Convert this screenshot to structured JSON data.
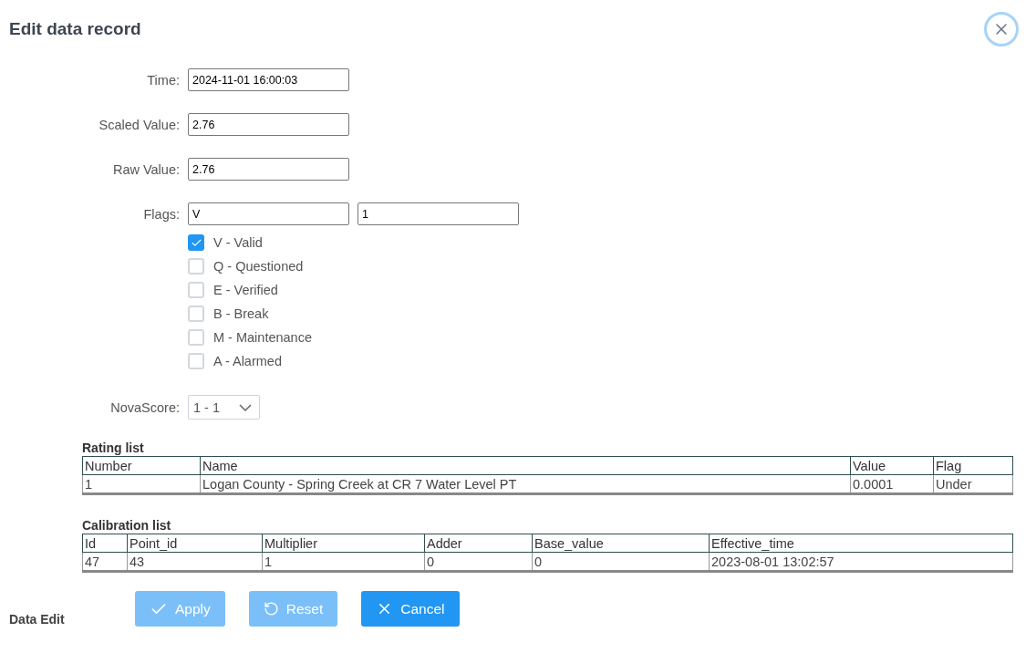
{
  "dialog": {
    "title": "Edit data record"
  },
  "fields": [
    {
      "label": "Time:",
      "value": "2024-11-01 16:00:03"
    },
    {
      "label": "Scaled Value:",
      "value": "2.76"
    },
    {
      "label": "Raw Value:",
      "value": "2.76"
    }
  ],
  "flags": {
    "label": "Flags:",
    "values": [
      "V",
      "1"
    ],
    "options": [
      {
        "label": "V - Valid",
        "checked": true
      },
      {
        "label": "Q - Questioned",
        "checked": false
      },
      {
        "label": "E - Verified",
        "checked": false
      },
      {
        "label": "B - Break",
        "checked": false
      },
      {
        "label": "M - Maintenance",
        "checked": false
      },
      {
        "label": "A - Alarmed",
        "checked": false
      }
    ]
  },
  "nova_score": {
    "label": "NovaScore:",
    "value": "1 - 1"
  },
  "rating_list": {
    "title": "Rating list",
    "columns": [
      "Number",
      "Name",
      "Value",
      "Flag"
    ],
    "rows": [
      [
        "1",
        "Logan County - Spring Creek at CR 7 Water Level PT",
        "0.0001",
        "Under"
      ]
    ]
  },
  "calibration_list": {
    "title": "Calibration list",
    "columns": [
      "Id",
      "Point_id",
      "Multiplier",
      "Adder",
      "Base_value",
      "Effective_time"
    ],
    "rows": [
      [
        "47",
        "43",
        "1",
        "0",
        "0",
        "2023-08-01 13:02:57"
      ]
    ]
  },
  "footer": {
    "label": "Data Edit"
  },
  "buttons": [
    {
      "kind": "apply",
      "label": "Apply",
      "disabled": true
    },
    {
      "kind": "reset",
      "label": "Reset",
      "disabled": true
    },
    {
      "kind": "cancel",
      "label": "Cancel",
      "disabled": false
    }
  ]
}
